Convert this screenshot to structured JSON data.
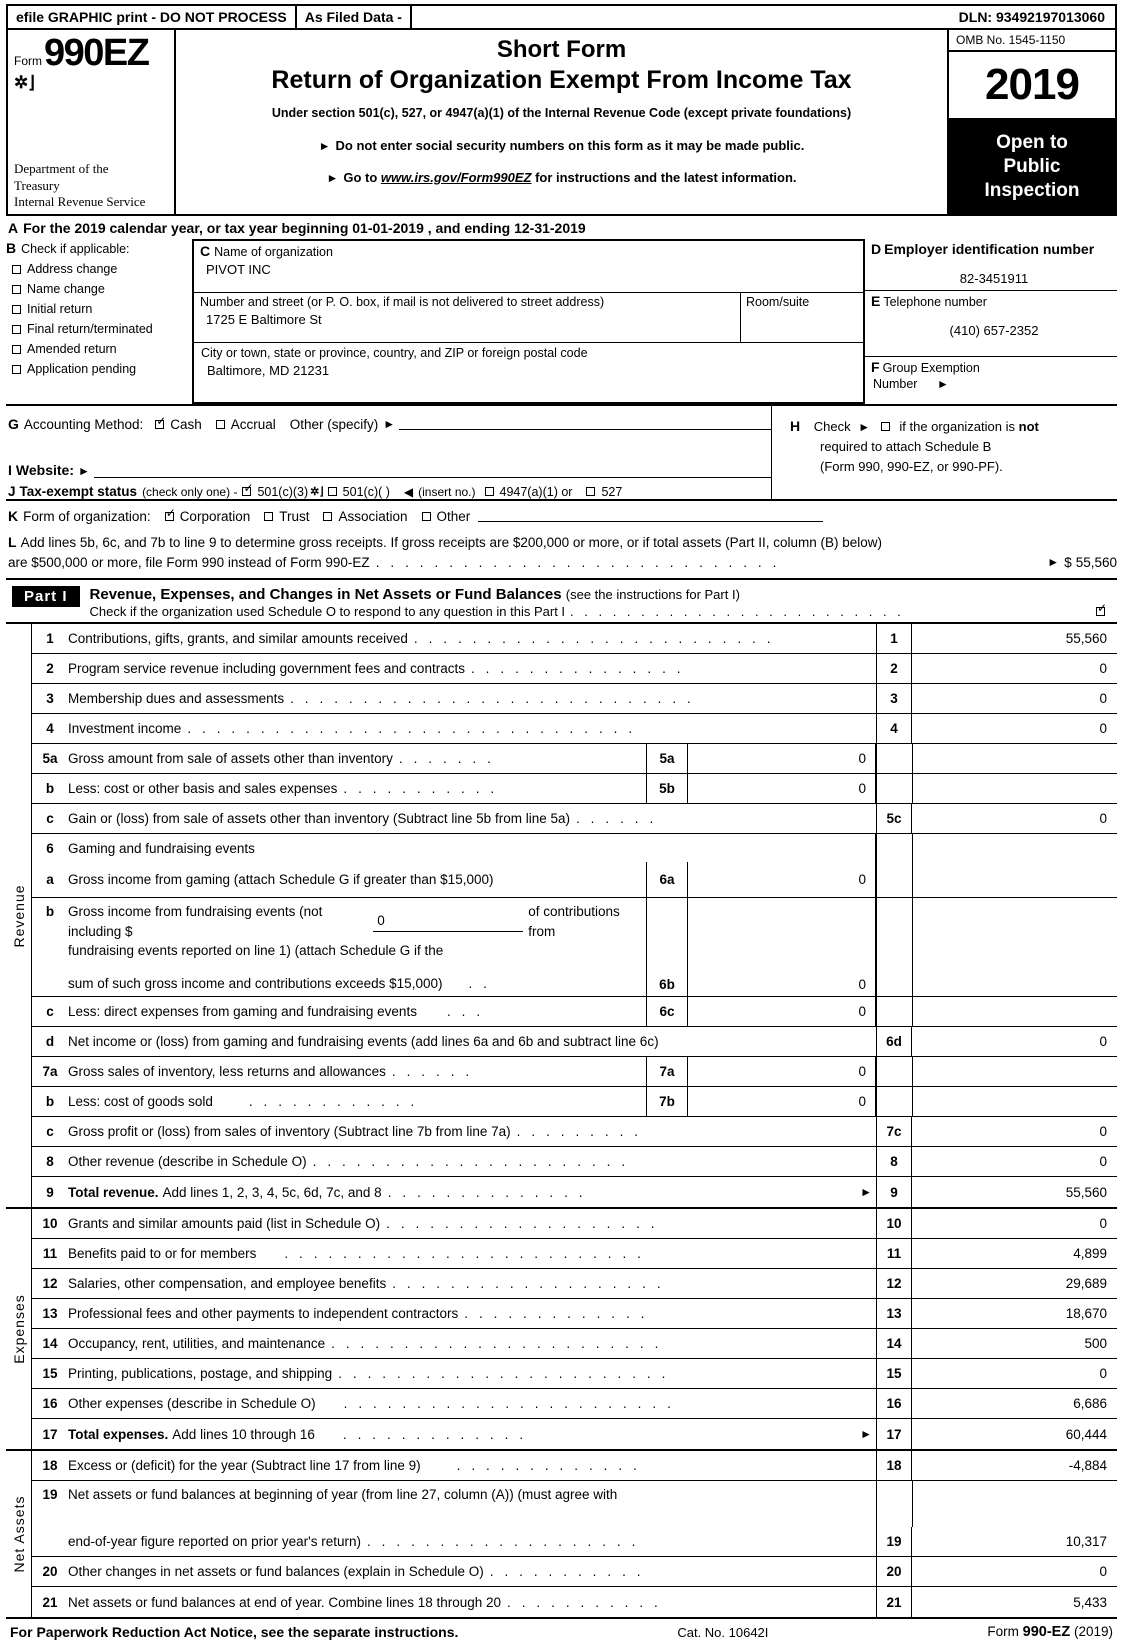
{
  "efile": {
    "graphic_print": "efile GRAPHIC print - DO NOT PROCESS",
    "as_filed": "As Filed Data -",
    "dln": "DLN: 93492197013060"
  },
  "masthead": {
    "form_word": "Form",
    "form_number": "990EZ",
    "department": "Department of the\nTreasury\nInternal Revenue Service",
    "dept_line1": "Department of the",
    "dept_line2": "Treasury",
    "dept_line3": "Internal Revenue Service",
    "short_form": "Short Form",
    "title": "Return of Organization Exempt From Income Tax",
    "under_section": "Under section 501(c), 527, or 4947(a)(1) of the Internal Revenue Code (except private foundations)",
    "bullet1": "Do not enter social security numbers on this form as it may be made public.",
    "bullet2_pre": "Go to",
    "bullet2_link": "www.irs.gov/Form990EZ",
    "bullet2_post": "for instructions and the latest information.",
    "omb": "OMB No. 1545-1150",
    "year": "2019",
    "open_to": "Open to",
    "public": "Public",
    "inspection": "Inspection"
  },
  "line_a": {
    "letter": "A",
    "text": "For the 2019 calendar year, or tax year beginning 01-01-2019 , and ending 12-31-2019"
  },
  "section_b": {
    "letter": "B",
    "heading": "Check if applicable:",
    "items": [
      {
        "label": "Address change",
        "checked": false
      },
      {
        "label": "Name change",
        "checked": false
      },
      {
        "label": "Initial return",
        "checked": false
      },
      {
        "label": "Final return/terminated",
        "checked": false
      },
      {
        "label": "Amended return",
        "checked": false
      },
      {
        "label": "Application pending",
        "checked": false
      }
    ]
  },
  "section_c": {
    "letter": "C",
    "name_label": "Name of organization",
    "name_value": "PIVOT INC",
    "street_label": "Number and street (or P. O. box, if mail is not delivered to street address)",
    "street_value": "1725 E Baltimore St",
    "room_label": "Room/suite",
    "room_value": "",
    "city_label": "City or town, state or province, country, and ZIP or foreign postal code",
    "city_value": "Baltimore, MD   21231"
  },
  "section_d": {
    "letter": "D",
    "ein_label": "Employer identification number",
    "ein_value": "82-3451911",
    "letter_e": "E",
    "phone_label": "Telephone number",
    "phone_value": "(410) 657-2352",
    "letter_f": "F",
    "group_label": "Group Exemption",
    "group_label2": "Number",
    "group_value": ""
  },
  "section_g": {
    "letter": "G",
    "label": "Accounting Method:",
    "cash": "Cash",
    "cash_checked": true,
    "accrual": "Accrual",
    "accrual_checked": false,
    "other": "Other (specify)",
    "other_value": ""
  },
  "section_h": {
    "letter": "H",
    "line1_pre": "Check",
    "line1_post_a": "if the organization is",
    "line1_post_b": "not",
    "line2": "required to attach Schedule B",
    "line3": "(Form 990, 990-EZ, or 990-PF).",
    "checked": false
  },
  "section_i": {
    "letter": "I",
    "label": "Website:",
    "value": ""
  },
  "section_j": {
    "letter": "J",
    "label": "Tax-exempt status",
    "note": "(check only one) -",
    "opt1": "501(c)(3)",
    "opt1_checked": true,
    "opt2": "501(c)(   )",
    "opt2_checked": false,
    "insert_no": "(insert no.)",
    "opt3": "4947(a)(1) or",
    "opt3_checked": false,
    "opt4": "527",
    "opt4_checked": false
  },
  "section_k": {
    "letter": "K",
    "label": "Form of organization:",
    "options": [
      {
        "label": "Corporation",
        "checked": true
      },
      {
        "label": "Trust",
        "checked": false
      },
      {
        "label": "Association",
        "checked": false
      },
      {
        "label": "Other",
        "checked": false
      }
    ]
  },
  "section_l": {
    "letter": "L",
    "line1": "Add lines 5b, 6c, and 7b to line 9 to determine gross receipts. If gross receipts are $200,000 or more, or if total assets (Part II, column (B) below)",
    "line2": "are $500,000 or more, file Form 990 instead of Form 990-EZ",
    "amount_prefix": "$",
    "amount": "55,560"
  },
  "part_i": {
    "badge": "Part I",
    "title": "Revenue, Expenses, and Changes in Net Assets or Fund Balances",
    "title_note": "(see the instructions for Part I)",
    "schedule_o_check": "Check if the organization used Schedule O to respond to any question in this Part I",
    "schedule_o_checked": true
  },
  "revenue": {
    "side_label": "Revenue",
    "rows": [
      {
        "no": "1",
        "text": "Contributions, gifts, grants, and similar amounts received",
        "out_no": "1",
        "value": "55,560"
      },
      {
        "no": "2",
        "text": "Program service revenue including government fees and contracts",
        "out_no": "2",
        "value": "0"
      },
      {
        "no": "3",
        "text": "Membership dues and assessments",
        "out_no": "3",
        "value": "0"
      },
      {
        "no": "4",
        "text": "Investment income",
        "out_no": "4",
        "value": "0"
      },
      {
        "no": "5a",
        "text": "Gross amount from sale of assets other than inventory",
        "inner_no": "5a",
        "inner_value": "0"
      },
      {
        "no": "b",
        "text": "Less: cost or other basis and sales expenses",
        "inner_no": "5b",
        "inner_value": "0"
      },
      {
        "no": "c",
        "text": "Gain or (loss) from sale of assets other than inventory (Subtract line 5b from line 5a)",
        "out_no": "5c",
        "value": "0"
      },
      {
        "no": "6",
        "text": "Gaming and fundraising events"
      },
      {
        "no": "a",
        "text": "Gross income from gaming (attach Schedule G if greater than $15,000)",
        "inner_no": "6a",
        "inner_value": "0"
      },
      {
        "no": "b",
        "text_l1a": "Gross income from fundraising events (not including $",
        "fill_value": "0",
        "text_l1b": "of contributions from",
        "text_l2": "fundraising events reported on line 1) (attach Schedule G if the",
        "text_l3": "sum of such gross income and contributions exceeds $15,000)",
        "inner_no": "6b",
        "inner_value": "0"
      },
      {
        "no": "c",
        "text": "Less: direct expenses from gaming and fundraising events",
        "inner_no": "6c",
        "inner_value": "0"
      },
      {
        "no": "d",
        "text": "Net income or (loss) from gaming and fundraising events (add lines 6a and 6b and subtract line 6c)",
        "out_no": "6d",
        "value": "0"
      },
      {
        "no": "7a",
        "text": "Gross sales of inventory, less returns and allowances",
        "inner_no": "7a",
        "inner_value": "0"
      },
      {
        "no": "b",
        "text": "Less: cost of goods sold",
        "inner_no": "7b",
        "inner_value": "0"
      },
      {
        "no": "c",
        "text": "Gross profit or (loss) from sales of inventory (Subtract line 7b from line 7a)",
        "out_no": "7c",
        "value": "0"
      },
      {
        "no": "8",
        "text": "Other revenue (describe in Schedule O)",
        "out_no": "8",
        "value": "0"
      },
      {
        "no": "9",
        "text_bold": "Total revenue.",
        "text": "Add lines 1, 2, 3, 4, 5c, 6d, 7c, and 8",
        "out_no": "9",
        "value": "55,560",
        "arrow": true
      }
    ]
  },
  "expenses": {
    "side_label": "Expenses",
    "rows": [
      {
        "no": "10",
        "text": "Grants and similar amounts paid (list in Schedule O)",
        "out_no": "10",
        "value": "0"
      },
      {
        "no": "11",
        "text": "Benefits paid to or for members",
        "out_no": "11",
        "value": "4,899"
      },
      {
        "no": "12",
        "text": "Salaries, other compensation, and employee benefits",
        "out_no": "12",
        "value": "29,689"
      },
      {
        "no": "13",
        "text": "Professional fees and other payments to independent contractors",
        "out_no": "13",
        "value": "18,670"
      },
      {
        "no": "14",
        "text": "Occupancy, rent, utilities, and maintenance",
        "out_no": "14",
        "value": "500"
      },
      {
        "no": "15",
        "text": "Printing, publications, postage, and shipping",
        "out_no": "15",
        "value": "0"
      },
      {
        "no": "16",
        "text": "Other expenses (describe in Schedule O)",
        "out_no": "16",
        "value": "6,686"
      },
      {
        "no": "17",
        "text_bold": "Total expenses.",
        "text": "Add lines 10 through 16",
        "out_no": "17",
        "value": "60,444",
        "arrow": true
      }
    ]
  },
  "net_assets": {
    "side_label": "Net Assets",
    "rows": [
      {
        "no": "18",
        "text": "Excess or (deficit) for the year (Subtract line 17 from line 9)",
        "out_no": "18",
        "value": "-4,884"
      },
      {
        "no": "19",
        "text_l1": "Net assets or fund balances at beginning of year (from line 27, column (A)) (must agree with",
        "text_l2": "end-of-year figure reported on prior year's return)",
        "out_no": "19",
        "value": "10,317"
      },
      {
        "no": "20",
        "text": "Other changes in net assets or fund balances (explain in Schedule O)",
        "out_no": "20",
        "value": "0"
      },
      {
        "no": "21",
        "text": "Net assets or fund balances at end of year. Combine lines 18 through 20",
        "out_no": "21",
        "value": "5,433"
      }
    ]
  },
  "footer": {
    "left": "For Paperwork Reduction Act Notice, see the separate instructions.",
    "cat": "Cat. No. 10642I",
    "right_pre": "Form",
    "right_bold": "990-EZ",
    "right_post": "(2019)"
  }
}
